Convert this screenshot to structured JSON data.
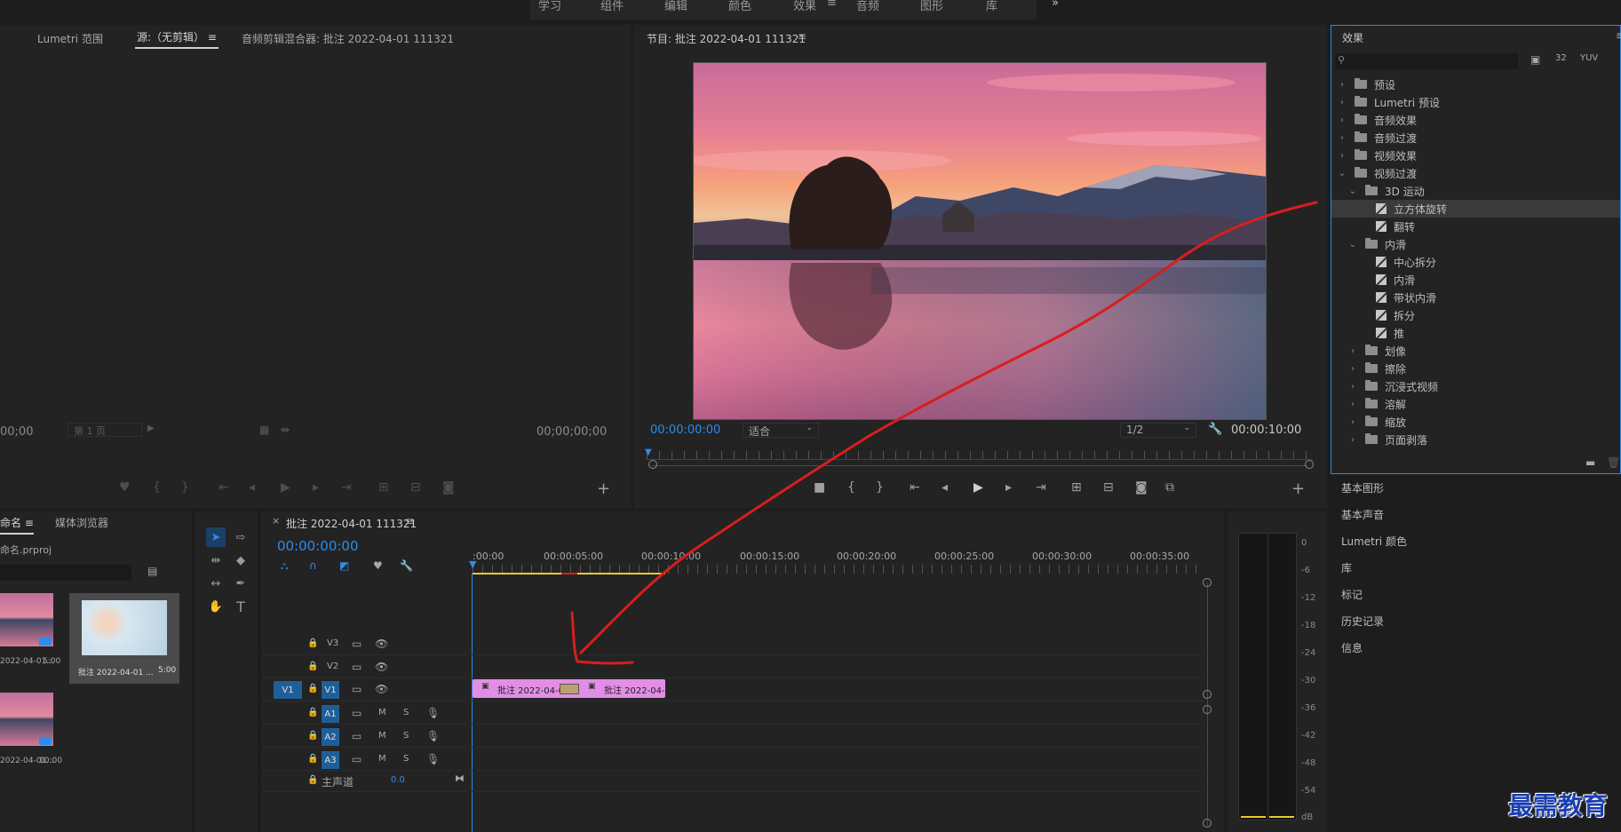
{
  "top_menu": [
    "学习",
    "组件",
    "编辑",
    "颜色",
    "效果",
    "音频",
    "图形",
    "库"
  ],
  "top_menu_active": "效果",
  "source_panel": {
    "tabs": [
      "Lumetri 范围",
      "源:（无剪辑）",
      "音频剪辑混合器: 批注 2022-04-01 111321"
    ],
    "timecode_left": "00;00",
    "page_label": "第 1 页",
    "timecode_right": "00;00;00;00"
  },
  "program_panel": {
    "title": "节目: 批注 2022-04-01 111321",
    "timecode": "00:00:00:00",
    "fit": "适合",
    "resolution": "1/2",
    "duration": "00:00:10:00"
  },
  "effects_panel": {
    "title": "效果",
    "tree": [
      {
        "label": "预设",
        "level": 0,
        "kind": "folder",
        "open": false
      },
      {
        "label": "Lumetri 预设",
        "level": 0,
        "kind": "folder",
        "open": false
      },
      {
        "label": "音频效果",
        "level": 0,
        "kind": "folder",
        "open": false
      },
      {
        "label": "音频过渡",
        "level": 0,
        "kind": "folder",
        "open": false
      },
      {
        "label": "视频效果",
        "level": 0,
        "kind": "folder",
        "open": false
      },
      {
        "label": "视频过渡",
        "level": 0,
        "kind": "folder",
        "open": true
      },
      {
        "label": "3D 运动",
        "level": 1,
        "kind": "folder",
        "open": true
      },
      {
        "label": "立方体旋转",
        "level": 2,
        "kind": "effect",
        "selected": true
      },
      {
        "label": "翻转",
        "level": 2,
        "kind": "effect"
      },
      {
        "label": "内滑",
        "level": 1,
        "kind": "folder",
        "open": true
      },
      {
        "label": "中心拆分",
        "level": 2,
        "kind": "effect"
      },
      {
        "label": "内滑",
        "level": 2,
        "kind": "effect"
      },
      {
        "label": "带状内滑",
        "level": 2,
        "kind": "effect"
      },
      {
        "label": "拆分",
        "level": 2,
        "kind": "effect"
      },
      {
        "label": "推",
        "level": 2,
        "kind": "effect"
      },
      {
        "label": "划像",
        "level": 1,
        "kind": "folder",
        "open": false
      },
      {
        "label": "擦除",
        "level": 1,
        "kind": "folder",
        "open": false
      },
      {
        "label": "沉浸式视频",
        "level": 1,
        "kind": "folder",
        "open": false
      },
      {
        "label": "溶解",
        "level": 1,
        "kind": "folder",
        "open": false
      },
      {
        "label": "缩放",
        "level": 1,
        "kind": "folder",
        "open": false
      },
      {
        "label": "页面剥落",
        "level": 1,
        "kind": "folder",
        "open": false
      }
    ]
  },
  "side_panels": [
    "基本图形",
    "基本声音",
    "Lumetri 颜色",
    "库",
    "标记",
    "历史记录",
    "信息"
  ],
  "project_panel": {
    "tabs": [
      "命名",
      "媒体浏览器"
    ],
    "filename": "命名.prproj",
    "items": [
      {
        "name": "2022-04-01...",
        "duration": "5:00"
      },
      {
        "name": "批注 2022-04-01 ...",
        "duration": "5:00"
      },
      {
        "name": "2022-04-01...",
        "duration": "10:00"
      }
    ]
  },
  "timeline": {
    "title": "批注 2022-04-01 111321",
    "timecode": "00:00:00:00",
    "ruler": [
      ":00:00",
      "00:00:05:00",
      "00:00:10:00",
      "00:00:15:00",
      "00:00:20:00",
      "00:00:25:00",
      "00:00:30:00",
      "00:00:35:00"
    ],
    "video_tracks": [
      "V3",
      "V2",
      "V1"
    ],
    "audio_tracks": [
      "A1",
      "A2",
      "A3"
    ],
    "source_patch": "V1",
    "master_label": "主声道",
    "master_value": "0.0",
    "clip_a": "批注 2022-04-0",
    "clip_b": "批注 2022-04-0",
    "mute": "M",
    "solo": "S"
  },
  "meter_scale": [
    "0",
    "-6",
    "-12",
    "-18",
    "-24",
    "-30",
    "-36",
    "-42",
    "-48",
    "-54",
    "dB"
  ],
  "watermark": "最需教育",
  "colors": {
    "accent": "#2d8ceb",
    "clip": "#e38ee6",
    "annotation": "#d81e1e"
  }
}
